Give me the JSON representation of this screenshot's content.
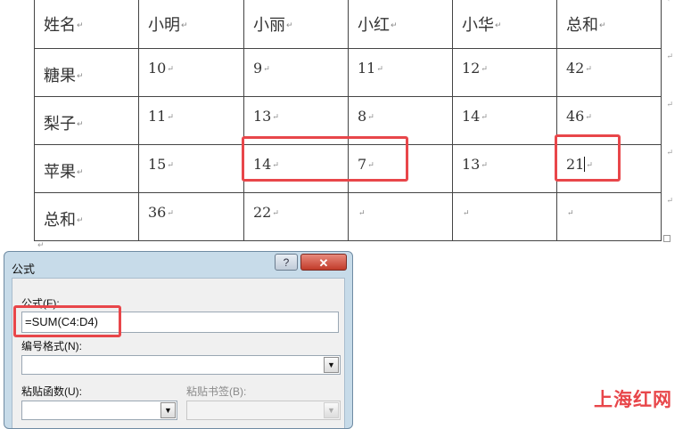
{
  "table": {
    "header": [
      "姓名",
      "小明",
      "小丽",
      "小红",
      "小华",
      "总和"
    ],
    "rows": [
      [
        "糖果",
        "10",
        "9",
        "11",
        "12",
        "42"
      ],
      [
        "梨子",
        "11",
        "13",
        "8",
        "14",
        "46"
      ],
      [
        "苹果",
        "15",
        "14",
        "7",
        "13",
        "21"
      ],
      [
        "总和",
        "36",
        "22",
        "",
        "",
        ""
      ]
    ]
  },
  "dialog": {
    "title": "公式",
    "help_label": "?",
    "close_label": "✕",
    "formula_label": "公式(F):",
    "formula_value": "=SUM(C4:D4)",
    "number_format_label": "编号格式(N):",
    "number_format_value": "",
    "paste_function_label": "粘贴函数(U):",
    "paste_function_value": "",
    "paste_bookmark_label": "粘贴书签(B):",
    "paste_bookmark_value": ""
  },
  "watermark": "上海红网",
  "colors": {
    "highlight": "#e8464a",
    "dialog_frame": "#c7dbe9",
    "close_button": "#c13b2a"
  }
}
